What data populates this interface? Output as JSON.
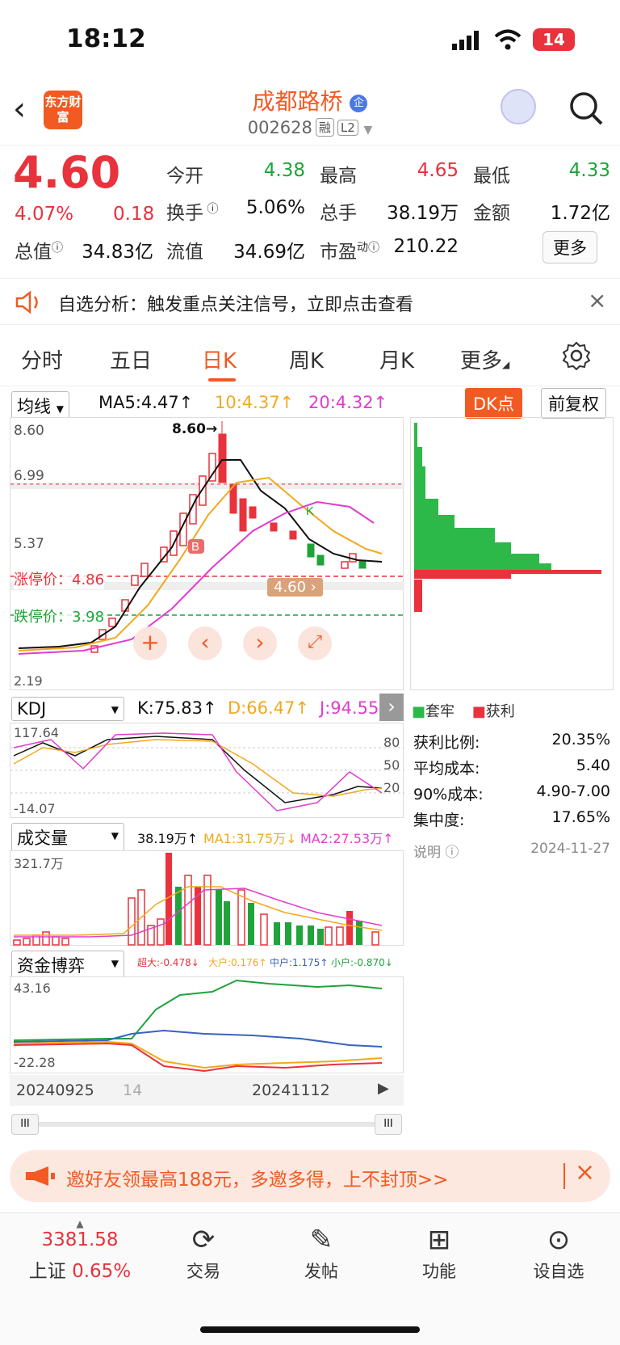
{
  "status": {
    "time": "18:12",
    "battery": "14"
  },
  "header": {
    "logo": "东方财富",
    "title": "成都路桥",
    "code": "002628",
    "tag1": "融",
    "tag2": "L2"
  },
  "quote": {
    "price": "4.60",
    "change_pct": "4.07%",
    "change": "0.18",
    "open_label": "今开",
    "open": "4.38",
    "high_label": "最高",
    "high": "4.65",
    "low_label": "最低",
    "low": "4.33",
    "turnover_label": "换手",
    "turnover": "5.06%",
    "volume_label": "总手",
    "volume": "38.19万",
    "amount_label": "金额",
    "amount": "1.72亿",
    "mktcap_label": "总值",
    "mktcap": "34.83亿",
    "float_label": "流值",
    "float": "34.69亿",
    "pe_label": "市盈",
    "pe_sup": "动",
    "pe": "210.22",
    "more": "更多"
  },
  "notice": {
    "text": "自选分析：触发重点关注信号，立即点击查看"
  },
  "tabs": [
    "分时",
    "五日",
    "日K",
    "周K",
    "月K",
    "更多"
  ],
  "kline": {
    "selector": "均线",
    "ma5": "MA5:4.47↑",
    "ma10": "10:4.37↑",
    "ma20": "20:4.32↑",
    "dk": "DK点",
    "adjust": "前复权",
    "y_labels": [
      "8.60",
      "6.99",
      "5.37"
    ],
    "high_mark": "8.60→",
    "limit_up": "涨停价：4.86",
    "limit_down": "跌停价：3.98",
    "price_tag": "4.60",
    "low_mark": "2.19",
    "marker_b": "B",
    "marker_k": "K"
  },
  "chip": {
    "legend_trapped": "套牢",
    "legend_profit": "获利",
    "rows": [
      {
        "label": "获利比例:",
        "value": "20.35%"
      },
      {
        "label": "平均成本:",
        "value": "5.40"
      },
      {
        "label": "90%成本:",
        "value": "4.90-7.00"
      },
      {
        "label": "集中度:",
        "value": "17.65%"
      }
    ],
    "note_label": "说明",
    "date": "2024-11-27"
  },
  "kdj": {
    "selector": "KDJ",
    "k": "K:75.83↑",
    "d": "D:66.47↑",
    "j": "J:94.55",
    "y_top": "117.64",
    "y_bottom": "-14.07",
    "levels": [
      "80",
      "50",
      "20"
    ]
  },
  "vol": {
    "selector": "成交量",
    "v": "38.19万↑",
    "ma1": "MA1:31.75万↓",
    "ma2": "MA2:27.53万↑",
    "y_top": "321.7万"
  },
  "fund": {
    "selector": "资金博弈",
    "super": "超大:-0.478↓",
    "big": "大户:0.176↑",
    "mid": "中户:1.175↑",
    "small": "小户:-0.870↓",
    "y_top": "43.16",
    "y_bottom": "-22.28"
  },
  "axis": {
    "date1": "20240925",
    "date1_tail": "14",
    "date2": "20241112"
  },
  "promo": {
    "text": "邀好友领最高188元，多邀多得，上不封顶>>"
  },
  "nav": {
    "index_value": "3381.58",
    "index_name": "上证",
    "index_pct": "0.65%",
    "items": [
      "交易",
      "发帖",
      "功能",
      "设自选"
    ]
  },
  "colors": {
    "up": "#e8323c",
    "down": "#1fa33a",
    "brand": "#f15a22",
    "ma10": "#f2a81d",
    "ma20": "#e03cd0"
  }
}
